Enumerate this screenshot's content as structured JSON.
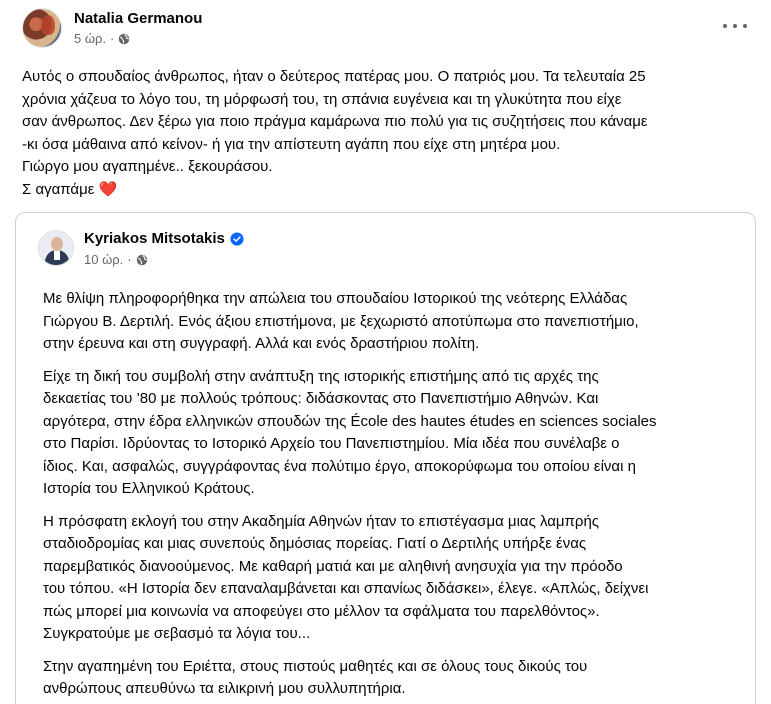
{
  "post": {
    "author": "Natalia Germanou",
    "time": "5 ώρ.",
    "separator": "·",
    "lines": [
      "Αυτός ο σπουδαίος άνθρωπος, ήταν ο δεύτερος πατέρας μου. Ο πατριός μου. Τα τελευταία 25",
      "χρόνια χάζευα το λόγο του, τη μόρφωσή του, τη σπάνια ευγένεια και τη γλυκύτητα που είχε",
      "σαν άνθρωπος. Δεν ξέρω για ποιο πράγμα καμάρωνα πιο πολύ για τις συζητήσεις που κάναμε",
      "-κι όσα μάθαινα από κείνον- ή για την απίστευτη αγάπη που είχε στη μητέρα μου.",
      "Γιώργο μου αγαπημένε.. ξεκουράσου.",
      "Σ αγαπάμε"
    ],
    "heart": "❤️"
  },
  "shared": {
    "author": "Kyriakos Mitsotakis",
    "time": "10 ώρ.",
    "separator": "·",
    "paragraphs": [
      [
        "Με θλίψη πληροφορήθηκα την απώλεια του σπουδαίου Ιστορικού της νεότερης Ελλάδας",
        "Γιώργου Β. Δερτιλή. Ενός άξιου επιστήμονα, με ξεχωριστό αποτύπωμα στο πανεπιστήμιο,",
        "στην έρευνα και στη συγγραφή. Αλλά και ενός δραστήριου πολίτη."
      ],
      [
        "Είχε τη δική του συμβολή στην ανάπτυξη της ιστορικής επιστήμης από τις αρχές της",
        "δεκαετίας του ’80 με πολλούς τρόπους: διδάσκοντας στο Πανεπιστήμιο Αθηνών. Και",
        "αργότερα, στην έδρα ελληνικών σπουδών της École des hautes études en sciences sociales",
        "στο Παρίσι. Ιδρύοντας το Ιστορικό Αρχείο του Πανεπιστημίου. Μία ιδέα που συνέλαβε ο",
        "ίδιος. Και, ασφαλώς, συγγράφοντας ένα πολύτιμο έργο, αποκορύφωμα του οποίου είναι η",
        "Ιστορία του Ελληνικού Κράτους."
      ],
      [
        "Η πρόσφατη εκλογή του στην Ακαδημία Αθηνών ήταν το επιστέγασμα μιας λαμπρής",
        "σταδιοδρομίας και μιας συνεπούς δημόσιας πορείας. Γιατί ο Δερτιλής υπήρξε ένας",
        "παρεμβατικός διανοούμενος. Με καθαρή ματιά και με αληθινή ανησυχία για την πρόοδο",
        "του τόπου. «Η Ιστορία δεν επαναλαμβάνεται και σπανίως διδάσκει», έλεγε. «Απλώς, δείχνει",
        "πώς μπορεί μια κοινωνία να αποφεύγει στο μέλλον τα σφάλματα του παρελθόντος».",
        "Συγκρατούμε με σεβασμό τα λόγια του..."
      ],
      [
        "Στην αγαπημένη του Εριέττα, στους πιστούς μαθητές και σε όλους τους δικούς του",
        "ανθρώπους απευθύνω τα ειλικρινή μου συλλυπητήρια."
      ]
    ]
  },
  "icons": {
    "globe": "globe-icon",
    "more": "more-options-icon",
    "verified": "verified-badge-icon"
  },
  "colors": {
    "text": "#050505",
    "secondary": "#65676b",
    "verified": "#0866ff",
    "heart": "#e41e3f",
    "border": "#ced0d4"
  }
}
